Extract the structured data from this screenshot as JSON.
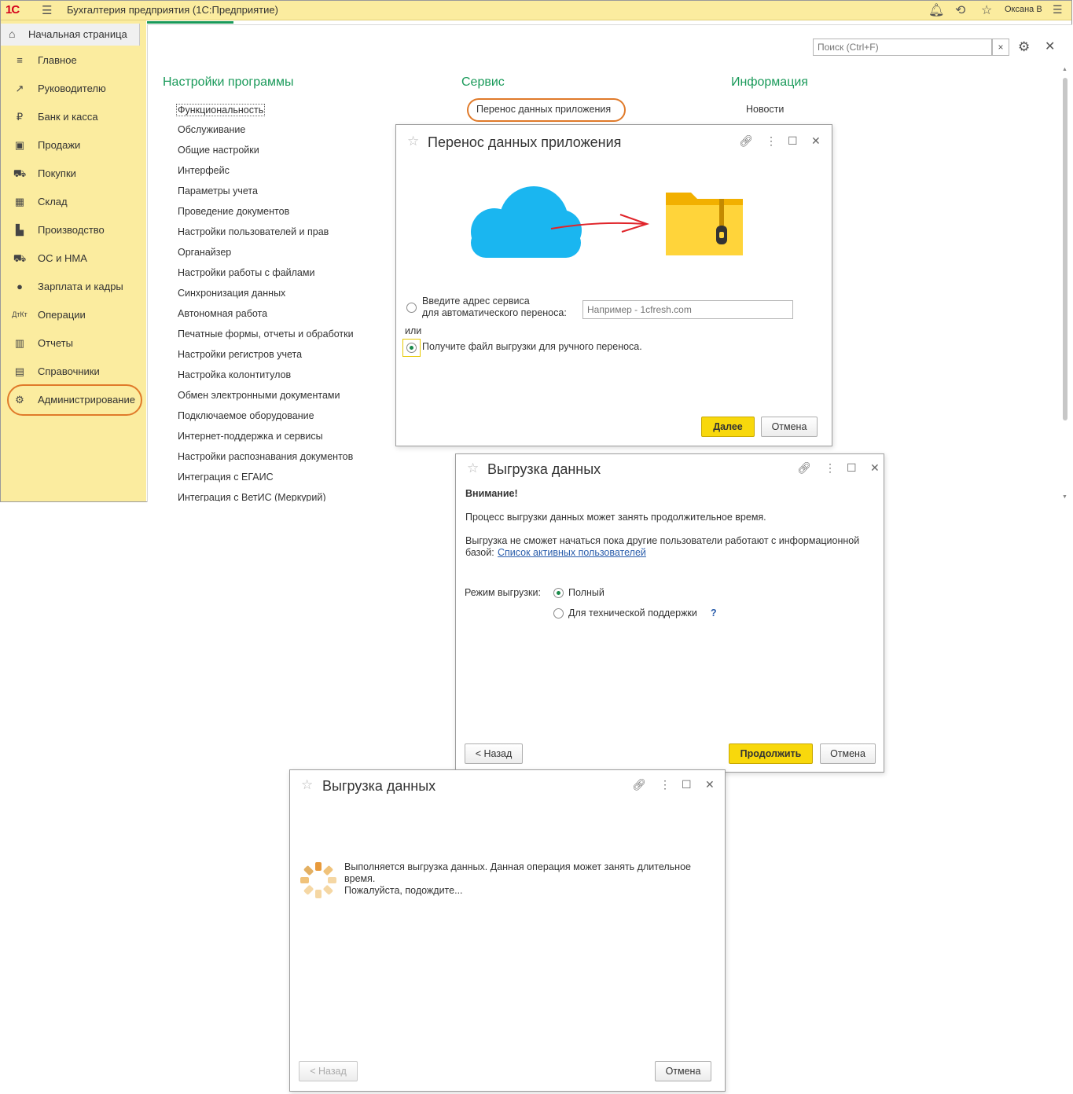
{
  "titlebar": {
    "logo": "1С",
    "title": "Бухгалтерия предприятия  (1С:Предприятие)",
    "user": "Оксана В"
  },
  "home": {
    "label": "Начальная страница"
  },
  "sidebar": {
    "items": [
      {
        "label": "Главное",
        "icon": "menu-icon"
      },
      {
        "label": "Руководителю",
        "icon": "trend-icon"
      },
      {
        "label": "Банк и касса",
        "icon": "ruble-icon"
      },
      {
        "label": "Продажи",
        "icon": "bag-icon"
      },
      {
        "label": "Покупки",
        "icon": "cart-icon"
      },
      {
        "label": "Склад",
        "icon": "warehouse-icon"
      },
      {
        "label": "Производство",
        "icon": "factory-icon"
      },
      {
        "label": "ОС и НМА",
        "icon": "truck-icon"
      },
      {
        "label": "Зарплата и кадры",
        "icon": "person-icon"
      },
      {
        "label": "Операции",
        "icon": "dt-kt-icon"
      },
      {
        "label": "Отчеты",
        "icon": "barchart-icon"
      },
      {
        "label": "Справочники",
        "icon": "books-icon"
      },
      {
        "label": "Администрирование",
        "icon": "gear-icon"
      }
    ]
  },
  "search": {
    "placeholder": "Поиск (Ctrl+F)",
    "clear": "×"
  },
  "sections": {
    "settings": {
      "title": "Настройки программы",
      "links": [
        "Функциональность",
        "Обслуживание",
        "Общие настройки",
        "Интерфейс",
        "Параметры учета",
        "Проведение документов",
        "Настройки пользователей и прав",
        "Органайзер",
        "Настройки работы с файлами",
        "Синхронизация данных",
        "Автономная работа",
        "Печатные формы, отчеты и обработки",
        "Настройки регистров учета",
        "Настройка колонтитулов",
        "Обмен электронными документами",
        "Подключаемое оборудование",
        "Интернет-поддержка и сервисы",
        "Настройки распознавания документов",
        "Интеграция с ЕГАИС",
        "Интеграция с ВетИС (Меркурий)"
      ]
    },
    "service": {
      "title": "Сервис",
      "links": [
        "Перенос данных приложения"
      ]
    },
    "info": {
      "title": "Информация",
      "links": [
        "Новости"
      ]
    }
  },
  "dialog1": {
    "title": "Перенос данных приложения",
    "option_service_line1": "Введите адрес сервиса",
    "option_service_line2": "для автоматического переноса:",
    "service_placeholder": "Например - 1cfresh.com",
    "or": "или",
    "option_file": "Получите файл выгрузки для ручного переноса.",
    "next": "Далее",
    "cancel": "Отмена"
  },
  "dialog2": {
    "title": "Выгрузка данных",
    "warning": "Внимание!",
    "text1": "Процесс выгрузки данных может занять продолжительное время.",
    "text2": "Выгрузка не сможет начаться пока другие пользователи работают с информационной",
    "text3": "базой:",
    "link": "Список активных пользователей",
    "mode_label": "Режим выгрузки:",
    "mode_full": "Полный",
    "mode_support": "Для технической поддержки",
    "help": "?",
    "back": "< Назад",
    "continue": "Продолжить",
    "cancel": "Отмена"
  },
  "dialog3": {
    "title": "Выгрузка данных",
    "text1": "Выполняется выгрузка данных. Данная операция может занять длительное",
    "text2": "время.",
    "text3": "Пожалуйста, подождите...",
    "back": "< Назад",
    "cancel": "Отмена"
  }
}
